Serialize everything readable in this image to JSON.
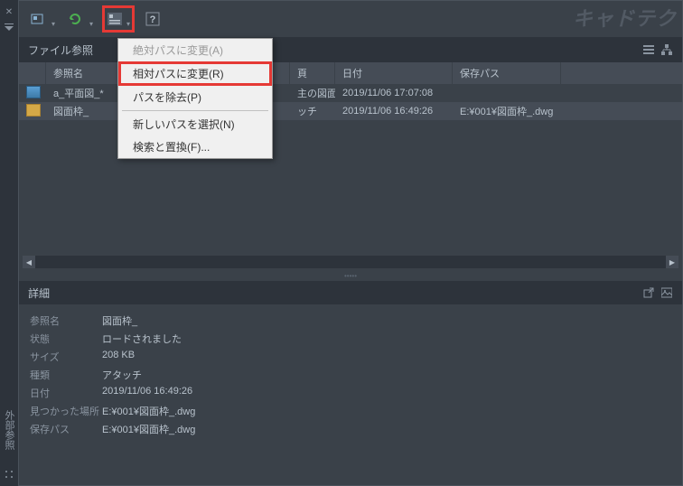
{
  "watermark": "キャドテク",
  "vertical_label": "外部参照",
  "panel_title": "ファイル参照",
  "columns": {
    "icon": "",
    "name": "参照名",
    "type": "頁",
    "date": "日付",
    "path": "保存パス"
  },
  "rows": [
    {
      "icon": "img",
      "name": "a_平面図_*",
      "type_fragment": "主の図面",
      "date": "2019/11/06 17:07:08",
      "path": ""
    },
    {
      "icon": "dwg",
      "name": "図面枠_",
      "type_fragment": "ッチ",
      "date": "2019/11/06 16:49:26",
      "path": "E:¥001¥図面枠_.dwg"
    }
  ],
  "details": {
    "title": "詳細",
    "items": [
      {
        "label": "参照名",
        "value": "図面枠_"
      },
      {
        "label": "状態",
        "value": "ロードされました"
      },
      {
        "label": "サイズ",
        "value": "208 KB"
      },
      {
        "label": "種類",
        "value": "アタッチ"
      },
      {
        "label": "日付",
        "value": "2019/11/06 16:49:26"
      },
      {
        "label": "見つかった場所",
        "value": "E:¥001¥図面枠_.dwg"
      },
      {
        "label": "保存パス",
        "value": "E:¥001¥図面枠_.dwg"
      }
    ]
  },
  "menu": {
    "absolute": "絶対パスに変更(A)",
    "relative": "相対パスに変更(R)",
    "remove": "パスを除去(P)",
    "newpath": "新しいパスを選択(N)",
    "find": "検索と置換(F)..."
  }
}
